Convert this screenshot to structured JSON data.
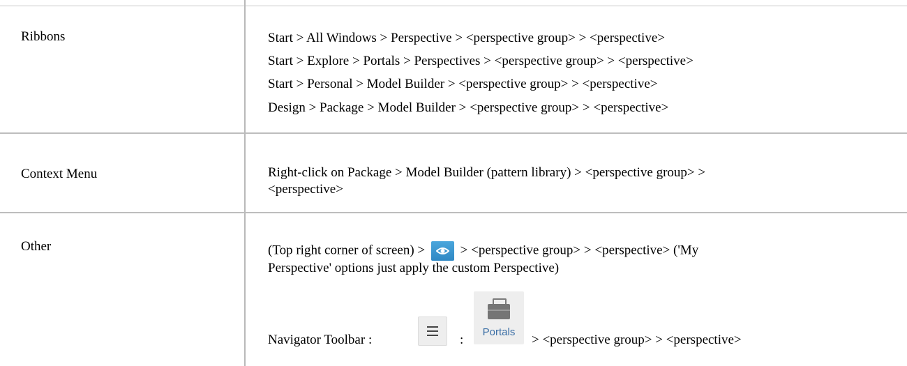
{
  "rows": [
    {
      "label": "Ribbons",
      "lines": [
        "Start > All Windows > Perspective > <perspective group> > <perspective>",
        "Start > Explore > Portals > Perspectives > <perspective group> > <perspective>",
        "Start > Personal > Model Builder > <perspective group> > <perspective>",
        "Design > Package > Model Builder > <perspective group> > <perspective>"
      ]
    },
    {
      "label": "Context Menu",
      "lines": [
        "Right-click on Package > Model Builder (pattern library) > <perspective group> >",
        "<perspective>"
      ]
    },
    {
      "label": "Other",
      "line1_pre": "(Top right corner of screen) >",
      "line1_post": "> <perspective group> > <perspective>    ('My",
      "line2": "Perspective' options just apply the custom Perspective)",
      "nav_label": "Navigator Toolbar :",
      "nav_sep": ":",
      "nav_post": "> <perspective group> > <perspective>",
      "portals_label": "Portals"
    }
  ],
  "icons": {
    "perspective": "eye-icon",
    "menu": "hamburger-menu-icon",
    "portals": "briefcase-icon"
  },
  "colors": {
    "eye_button": "#3a97d2",
    "portals_text": "#3a6ea5",
    "grid_lines": "#bdbdbd"
  }
}
